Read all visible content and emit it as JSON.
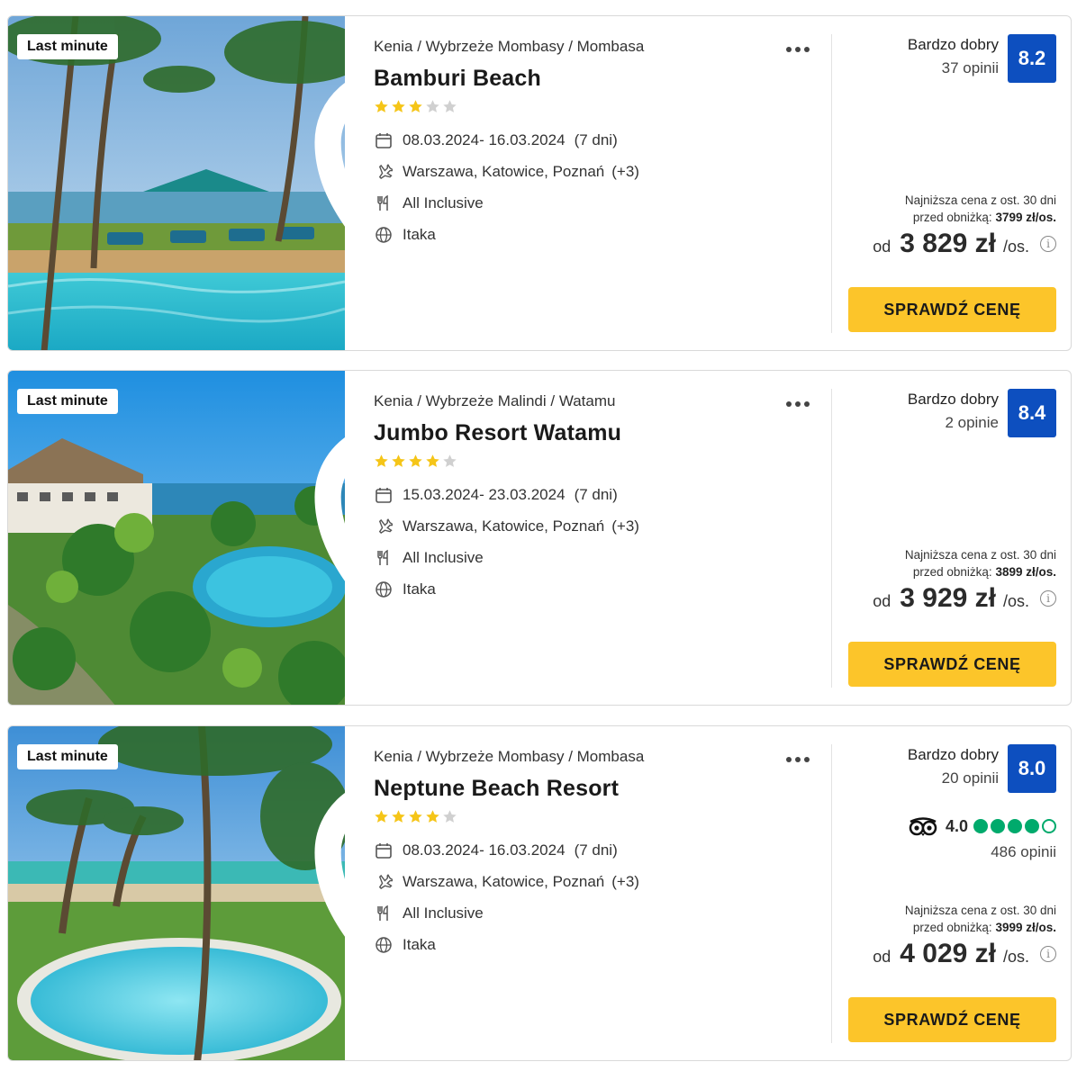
{
  "offers": [
    {
      "badge": "Last minute",
      "location": "Kenia / Wybrzeże Mombasy / Mombasa",
      "name": "Bamburi Beach",
      "stars": 3,
      "dates": "08.03.2024- 16.03.2024",
      "duration": "(7 dni)",
      "cities": "Warszawa, Katowice, Poznań",
      "cities_extra": "(+3)",
      "board": "All Inclusive",
      "operator": "Itaka",
      "rating_label": "Bardzo dobry",
      "rating_count": "37 opinii",
      "score": "8.2",
      "price_note_line1": "Najniższa cena z ost. 30 dni",
      "price_note_line2": "przed obniżką:",
      "price_note_value": "3799 zł/os.",
      "price_prefix": "od",
      "price": "3 829 zł",
      "price_suffix": "/os.",
      "cta": "SPRAWDŹ CENĘ"
    },
    {
      "badge": "Last minute",
      "location": "Kenia / Wybrzeże Malindi / Watamu",
      "name": "Jumbo Resort Watamu",
      "stars": 4,
      "dates": "15.03.2024- 23.03.2024",
      "duration": "(7 dni)",
      "cities": "Warszawa, Katowice, Poznań",
      "cities_extra": "(+3)",
      "board": "All Inclusive",
      "operator": "Itaka",
      "rating_label": "Bardzo dobry",
      "rating_count": "2 opinie",
      "score": "8.4",
      "price_note_line1": "Najniższa cena z ost. 30 dni",
      "price_note_line2": "przed obniżką:",
      "price_note_value": "3899 zł/os.",
      "price_prefix": "od",
      "price": "3 929 zł",
      "price_suffix": "/os.",
      "cta": "SPRAWDŹ CENĘ"
    },
    {
      "badge": "Last minute",
      "location": "Kenia / Wybrzeże Mombasy / Mombasa",
      "name": "Neptune Beach Resort",
      "stars": 4,
      "dates": "08.03.2024- 16.03.2024",
      "duration": "(7 dni)",
      "cities": "Warszawa, Katowice, Poznań",
      "cities_extra": "(+3)",
      "board": "All Inclusive",
      "operator": "Itaka",
      "rating_label": "Bardzo dobry",
      "rating_count": "20 opinii",
      "score": "8.0",
      "tripadvisor_score": "4.0",
      "tripadvisor_bubbles": 4,
      "tripadvisor_count": "486 opinii",
      "price_note_line1": "Najniższa cena z ost. 30 dni",
      "price_note_line2": "przed obniżką:",
      "price_note_value": "3999 zł/os.",
      "price_prefix": "od",
      "price": "4 029 zł",
      "price_suffix": "/os.",
      "cta": "SPRAWDŹ CENĘ"
    }
  ],
  "colors": {
    "score_bg": "#0d4fbf",
    "cta_bg": "#fcc52a",
    "star_filled": "#f5c518",
    "star_empty": "#d0d0d0",
    "tripadvisor": "#00aa6c"
  }
}
